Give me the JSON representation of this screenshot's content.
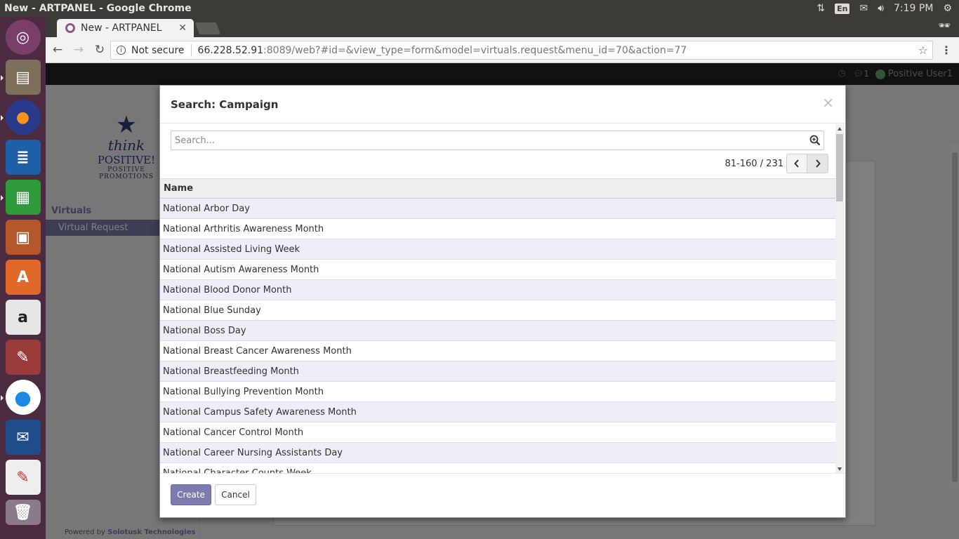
{
  "os": {
    "window_title": "New - ARTPANEL - Google Chrome",
    "lang": "En",
    "time": "7:19 PM"
  },
  "launcher": {
    "items": [
      "ubuntu-dash",
      "files",
      "firefox",
      "writer",
      "calc",
      "impress",
      "software-center",
      "amazon",
      "system-settings",
      "chrome",
      "thunderbird",
      "document-viewer",
      "trash"
    ]
  },
  "browser": {
    "tab_title": "New - ARTPANEL",
    "security": "Not secure",
    "url_host": "66.228.52.91",
    "url_rest": ":8089/web?#id=&view_type=form&model=virtuals.request&menu_id=70&action=77"
  },
  "app": {
    "user": "Positive User1",
    "chat_count": "1",
    "logo": {
      "line1": "think",
      "line2": "POSITIVE!",
      "line3": "POSITIVE PROMOTIONS"
    },
    "menu_section": "Virtuals",
    "menu_item": "Virtual Request",
    "powered_prefix": "Powered by ",
    "powered_by": "Solotusk Technologies"
  },
  "dialog": {
    "title": "Search: Campaign",
    "search_placeholder": "Search...",
    "pager": "81-160 / 231",
    "column_name": "Name",
    "rows": [
      "National Arbor Day",
      "National Arthritis Awareness Month",
      "National Assisted Living Week",
      "National Autism Awareness Month",
      "National Blood Donor Month",
      "National Blue Sunday",
      "National Boss Day",
      "National Breast Cancer Awareness Month",
      "National Breastfeeding Month",
      "National Bullying Prevention Month",
      "National Campus Safety Awareness Month",
      "National Cancer Control Month",
      "National Career Nursing Assistants Day",
      "National Character Counts Week"
    ],
    "create_label": "Create",
    "cancel_label": "Cancel"
  },
  "colors": {
    "brand": "#7c7bad",
    "launcher": "#4a2b40",
    "panel": "#3c3b37"
  }
}
